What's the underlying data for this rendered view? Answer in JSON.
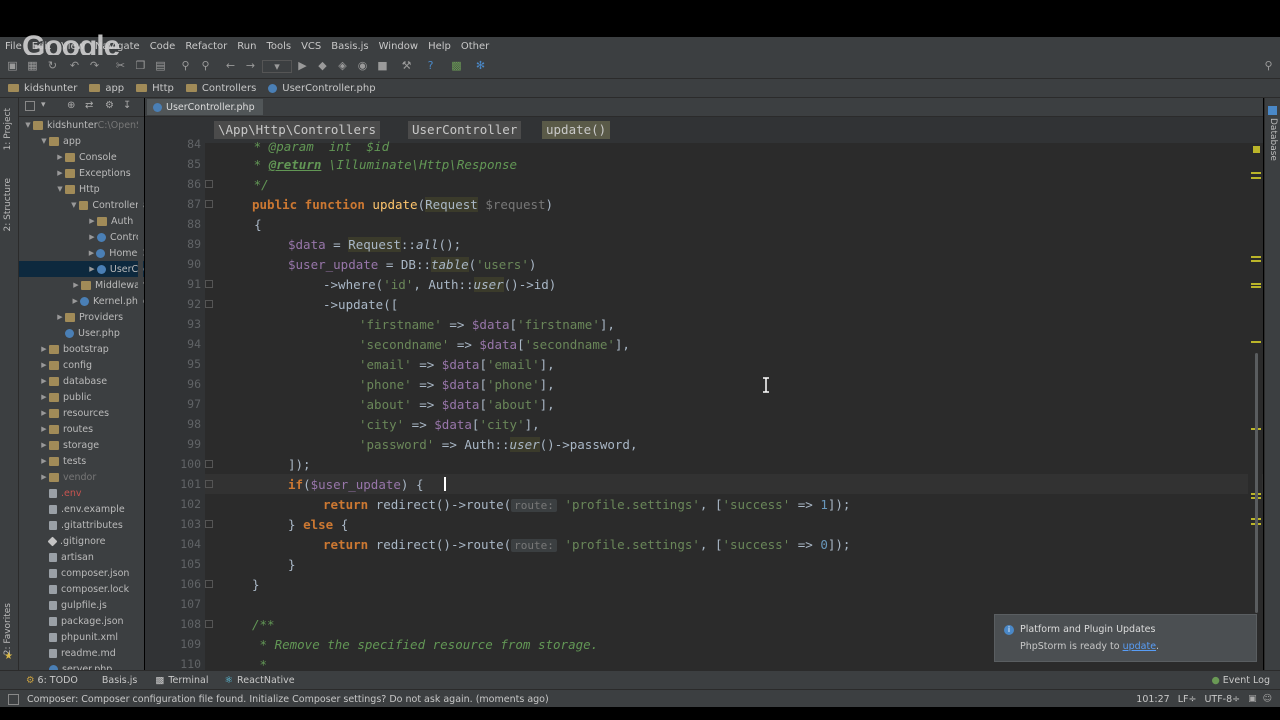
{
  "overlay_logo": "Google",
  "menu": [
    "File",
    "Edit",
    "View",
    "Navigate",
    "Code",
    "Refactor",
    "Run",
    "Tools",
    "VCS",
    "Basis.js",
    "Window",
    "Help",
    "Other"
  ],
  "navbar": {
    "crumbs": [
      "kidshunter",
      "app",
      "Http",
      "Controllers",
      "UserController.php"
    ]
  },
  "left_strip": {
    "project_tab": "1: Project",
    "structure_tab": "2: Structure",
    "favorites_tab": "2: Favorites"
  },
  "right_strip": {
    "database_tab": "Database"
  },
  "tree": [
    {
      "label": "kidshunter",
      "suffix": "C:\\OpenS",
      "depth": 0,
      "type": "folder",
      "open": true
    },
    {
      "label": "app",
      "depth": 1,
      "type": "folder",
      "open": true
    },
    {
      "label": "Console",
      "depth": 2,
      "type": "folder",
      "open": false
    },
    {
      "label": "Exceptions",
      "depth": 2,
      "type": "folder",
      "open": false
    },
    {
      "label": "Http",
      "depth": 2,
      "type": "folder",
      "open": true
    },
    {
      "label": "Controllers",
      "depth": 3,
      "type": "folder",
      "open": true
    },
    {
      "label": "Auth",
      "depth": 4,
      "type": "folder",
      "open": false
    },
    {
      "label": "Contro",
      "depth": 4,
      "type": "php",
      "open": false
    },
    {
      "label": "HomeC",
      "depth": 4,
      "type": "php",
      "open": false
    },
    {
      "label": "UserCo",
      "depth": 4,
      "type": "php",
      "open": false,
      "selected": true
    },
    {
      "label": "Middlewar",
      "depth": 3,
      "type": "folder",
      "open": false
    },
    {
      "label": "Kernel.php",
      "depth": 3,
      "type": "php",
      "open": false
    },
    {
      "label": "Providers",
      "depth": 2,
      "type": "folder",
      "open": false
    },
    {
      "label": "User.php",
      "depth": 2,
      "type": "php",
      "leaf": true
    },
    {
      "label": "bootstrap",
      "depth": 1,
      "type": "folder",
      "open": false
    },
    {
      "label": "config",
      "depth": 1,
      "type": "folder",
      "open": false
    },
    {
      "label": "database",
      "depth": 1,
      "type": "folder",
      "open": false
    },
    {
      "label": "public",
      "depth": 1,
      "type": "folder",
      "open": false
    },
    {
      "label": "resources",
      "depth": 1,
      "type": "folder",
      "open": false
    },
    {
      "label": "routes",
      "depth": 1,
      "type": "folder",
      "open": false
    },
    {
      "label": "storage",
      "depth": 1,
      "type": "folder",
      "open": false
    },
    {
      "label": "tests",
      "depth": 1,
      "type": "folder",
      "open": false
    },
    {
      "label": "vendor",
      "depth": 1,
      "type": "folder",
      "open": false,
      "dim": true
    },
    {
      "label": ".env",
      "depth": 1,
      "type": "file",
      "leaf": true,
      "dim": true
    },
    {
      "label": ".env.example",
      "depth": 1,
      "type": "file",
      "leaf": true
    },
    {
      "label": ".gitattributes",
      "depth": 1,
      "type": "file",
      "leaf": true
    },
    {
      "label": ".gitignore",
      "depth": 1,
      "type": "git",
      "leaf": true
    },
    {
      "label": "artisan",
      "depth": 1,
      "type": "file",
      "leaf": true
    },
    {
      "label": "composer.json",
      "depth": 1,
      "type": "file",
      "leaf": true
    },
    {
      "label": "composer.lock",
      "depth": 1,
      "type": "file",
      "leaf": true
    },
    {
      "label": "gulpfile.js",
      "depth": 1,
      "type": "file",
      "leaf": true
    },
    {
      "label": "package.json",
      "depth": 1,
      "type": "file",
      "leaf": true
    },
    {
      "label": "phpunit.xml",
      "depth": 1,
      "type": "file",
      "leaf": true
    },
    {
      "label": "readme.md",
      "depth": 1,
      "type": "file",
      "leaf": true
    },
    {
      "label": "server.php",
      "depth": 1,
      "type": "php",
      "leaf": true
    }
  ],
  "editor": {
    "tab_label": "UserController.php",
    "breadcrumbs": [
      "\\App\\Http\\Controllers",
      "UserController",
      "update()"
    ],
    "line_numbers": [
      "84",
      "85",
      "86",
      "87",
      "88",
      "89",
      "90",
      "91",
      "92",
      "93",
      "94",
      "95",
      "96",
      "97",
      "98",
      "99",
      "100",
      "101",
      "102",
      "103",
      "104",
      "105",
      "106",
      "107",
      "108",
      "109",
      "110"
    ],
    "lines": {
      "l84": "     * @param  int  $id",
      "l85_pre": "     * ",
      "l85_tag": "@return",
      "l85_post": " \\Illuminate\\Http\\Response",
      "l86": "     */",
      "l87_kw1": "public function ",
      "l87_fn": "update",
      "l87_p1": "(",
      "l87_cls": "Request",
      "l87_sp": " ",
      "l87_var": "$request",
      "l87_p2": ")",
      "l88": "    {",
      "l89_var": "$data",
      "l89_eq": " = ",
      "l89_cls": "Request",
      "l89_dc": "::",
      "l89_m": "all",
      "l89_end": "();",
      "l90_var": "$user_update",
      "l90_eq": " = DB::",
      "l90_m": "table",
      "l90_p": "(",
      "l90_s": "'users'",
      "l90_end": ")",
      "l91_pre": "->where(",
      "l91_s": "'id'",
      "l91_mid": ", Auth::",
      "l91_m": "user",
      "l91_end": "()->id)",
      "l92": "->update([",
      "l93_s1": "'firstname'",
      "l93_op": " => ",
      "l93_v": "$data",
      "l93_b1": "[",
      "l93_s2": "'firstname'",
      "l93_b2": "],",
      "l94_s1": "'secondname'",
      "l94_op": " => ",
      "l94_v": "$data",
      "l94_b1": "[",
      "l94_s2": "'secondname'",
      "l94_b2": "],",
      "l95_s1": "'email'",
      "l95_op": " => ",
      "l95_v": "$data",
      "l95_b1": "[",
      "l95_s2": "'email'",
      "l95_b2": "],",
      "l96_s1": "'phone'",
      "l96_op": " => ",
      "l96_v": "$data",
      "l96_b1": "[",
      "l96_s2": "'phone'",
      "l96_b2": "],",
      "l97_s1": "'about'",
      "l97_op": " => ",
      "l97_v": "$data",
      "l97_b1": "[",
      "l97_s2": "'about'",
      "l97_b2": "],",
      "l98_s1": "'city'",
      "l98_op": " => ",
      "l98_v": "$data",
      "l98_b1": "[",
      "l98_s2": "'city'",
      "l98_b2": "],",
      "l99_s1": "'password'",
      "l99_op": " => Auth::",
      "l99_m": "user",
      "l99_end": "()->password,",
      "l100": "]);",
      "l101_kw": "if",
      "l101_p": "(",
      "l101_var": "$user_update",
      "l101_end": ") {",
      "l102_kw": "return ",
      "l102_a": "redirect()->route(",
      "l102_hint": "route:",
      "l102_s1": "'profile.settings'",
      "l102_c": ", [",
      "l102_s2": "'success'",
      "l102_op": " => ",
      "l102_n": "1",
      "l102_end": "]);",
      "l103_a": "} ",
      "l103_kw": "else",
      "l103_end": " {",
      "l104_kw": "return ",
      "l104_a": "redirect()->route(",
      "l104_hint": "route:",
      "l104_s1": "'profile.settings'",
      "l104_c": ", [",
      "l104_s2": "'success'",
      "l104_op": " => ",
      "l104_n": "0",
      "l104_end": "]);",
      "l105": "}",
      "l106": "}",
      "l107": "",
      "l108": "/**",
      "l109": " * Remove the specified resource from storage.",
      "l110": " *"
    }
  },
  "notification": {
    "title": "Platform and Plugin Updates",
    "text": "PhpStorm is ready to ",
    "link": "update",
    "tail": "."
  },
  "bottom_tabs": [
    "6: TODO",
    "Basis.js",
    "Terminal",
    "ReactNative"
  ],
  "event_log": "Event Log",
  "status": {
    "message": "Composer: Composer configuration file found. Initialize Composer settings? Do not ask again. (moments ago)",
    "position": "101:27",
    "line_sep": "LF÷",
    "encoding": "UTF-8÷"
  }
}
